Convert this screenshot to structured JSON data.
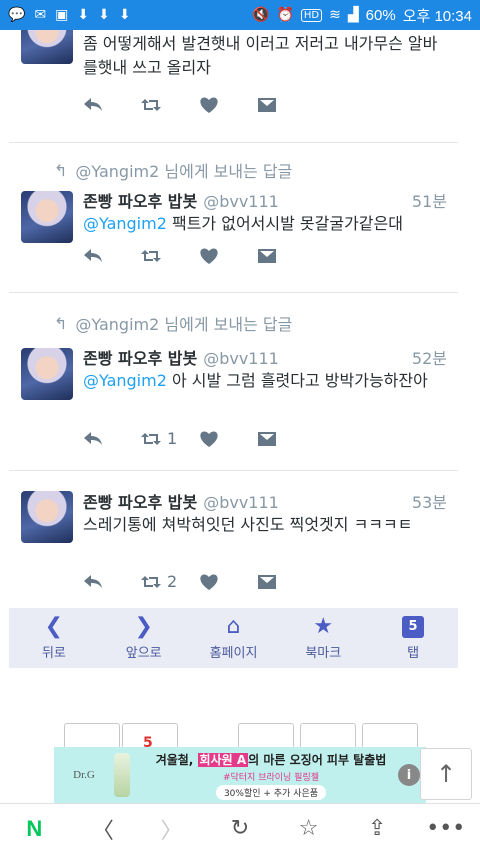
{
  "statusbar": {
    "left_icons": [
      "chat-icon",
      "mail-icon",
      "image-icon",
      "download-icon",
      "download-icon",
      "download-icon"
    ],
    "hd": "HD",
    "battery": "60%",
    "time": "오후 10:34"
  },
  "tweets": [
    {
      "text": "좀 어떻게해서 발견햇내 이러고 저러고 내가무슨 알바를햇내 쓰고 올리자",
      "retweets": "",
      "likes": ""
    },
    {
      "context": "@Yangim2 님에게 보내는 답글",
      "name": "존빵 파오후 밥봇",
      "screen_name": "@bvv111",
      "time": "51분",
      "mention": "@Yangim2",
      "text": " 팩트가 없어서시발 못갈굴가같은대",
      "retweets": "",
      "likes": ""
    },
    {
      "context": "@Yangim2 님에게 보내는 답글",
      "name": "존빵 파오후 밥봇",
      "screen_name": "@bvv111",
      "time": "52분",
      "mention": "@Yangim2",
      "text": " 아 시발 그럼 흘렷다고 방박가능하잔아",
      "retweets": "1",
      "likes": ""
    },
    {
      "name": "존빵 파오후 밥봇",
      "screen_name": "@bvv111",
      "time": "53분",
      "text": "스레기통에 쳐박혀잇던 사진도 찍엇겟지 ㅋㅋㅋㅌ",
      "retweets": "2",
      "likes": ""
    }
  ],
  "webnav": {
    "back": "뒤로",
    "forward": "앞으로",
    "home": "홈페이지",
    "bookmark": "북마크",
    "tabs": "탭",
    "tab_count": "5"
  },
  "strip": {
    "number": "5"
  },
  "ad": {
    "logo": "Dr.G",
    "headline_pre": "겨울철, ",
    "headline_hl": "회사원 A",
    "headline_post": "의 마른 오징어 피부 탈출법",
    "sub": "#닥터지 브라이닝 필링젤",
    "pill": "30%할인 + 추가 사은품",
    "info": "i"
  },
  "appbar": {
    "brand": "N"
  }
}
